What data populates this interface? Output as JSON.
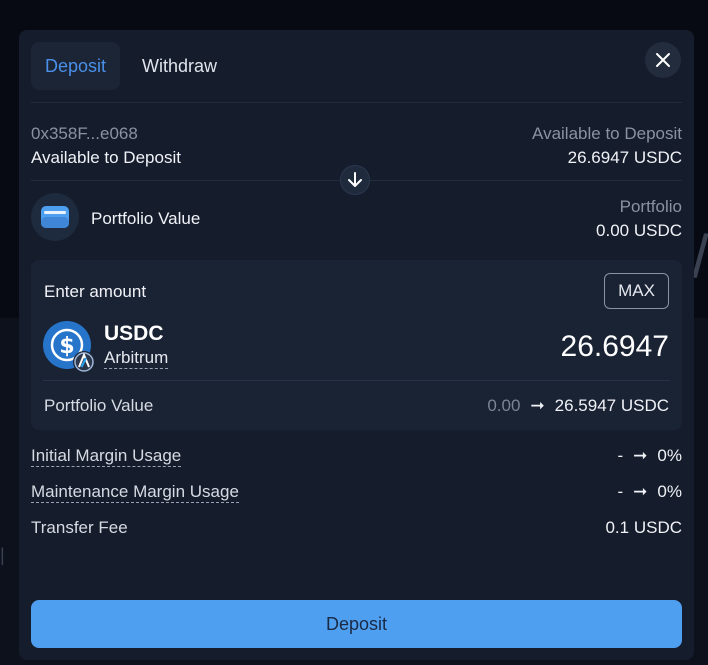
{
  "tabs": [
    {
      "label": "Deposit",
      "active": true
    },
    {
      "label": "Withdraw",
      "active": false
    }
  ],
  "source": {
    "address": "0x358F...e068",
    "label": "Available to Deposit",
    "right_label": "Available to Deposit",
    "right_value": "26.6947 USDC"
  },
  "destination": {
    "label": "Portfolio Value",
    "right_label": "Portfolio",
    "right_value": "0.00 USDC"
  },
  "amount_card": {
    "label": "Enter amount",
    "max_label": "MAX",
    "token": "USDC",
    "network": "Arbitrum",
    "amount": "26.6947",
    "portfolio_label": "Portfolio Value",
    "portfolio_from": "0.00",
    "portfolio_to": "26.5947 USDC"
  },
  "details": [
    {
      "label": "Initial Margin Usage",
      "from": "-",
      "to": "0%"
    },
    {
      "label": "Maintenance Margin Usage",
      "from": "-",
      "to": "0%"
    },
    {
      "label": "Transfer Fee",
      "value": "0.1 USDC"
    }
  ],
  "deposit_button": "Deposit",
  "colors": {
    "accent": "#4a90e8",
    "button": "#4f9ff0",
    "modal_bg": "#151c2b",
    "card_bg": "#1a2334"
  }
}
